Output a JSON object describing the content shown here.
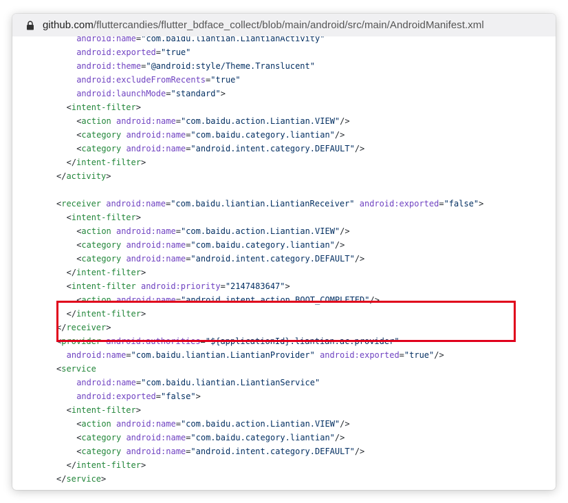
{
  "browser": {
    "url_host": "github.com",
    "url_path": "/fluttercandies/flutter_bdface_collect/blob/main/android/src/main/AndroidManifest.xml",
    "lock_icon": "lock-icon"
  },
  "code": {
    "lines": [
      {
        "indent": 8,
        "tokens": [
          {
            "k": "a",
            "v": "android:name"
          },
          {
            "k": "p",
            "v": "="
          },
          {
            "k": "s",
            "v": "\"com.baidu.liantian.LiantianActivity\""
          }
        ]
      },
      {
        "indent": 8,
        "tokens": [
          {
            "k": "a",
            "v": "android:exported"
          },
          {
            "k": "p",
            "v": "="
          },
          {
            "k": "s",
            "v": "\"true\""
          }
        ]
      },
      {
        "indent": 8,
        "tokens": [
          {
            "k": "a",
            "v": "android:theme"
          },
          {
            "k": "p",
            "v": "="
          },
          {
            "k": "s",
            "v": "\"@android:style/Theme.Translucent\""
          }
        ]
      },
      {
        "indent": 8,
        "tokens": [
          {
            "k": "a",
            "v": "android:excludeFromRecents"
          },
          {
            "k": "p",
            "v": "="
          },
          {
            "k": "s",
            "v": "\"true\""
          }
        ]
      },
      {
        "indent": 8,
        "tokens": [
          {
            "k": "a",
            "v": "android:launchMode"
          },
          {
            "k": "p",
            "v": "="
          },
          {
            "k": "s",
            "v": "\"standard\""
          },
          {
            "k": "p",
            "v": ">"
          }
        ]
      },
      {
        "indent": 4,
        "tokens": [
          {
            "k": "p",
            "v": "<"
          },
          {
            "k": "t",
            "v": "intent-filter"
          },
          {
            "k": "p",
            "v": ">"
          }
        ]
      },
      {
        "indent": 8,
        "tokens": [
          {
            "k": "p",
            "v": "<"
          },
          {
            "k": "t",
            "v": "action"
          },
          {
            "k": "p",
            "v": " "
          },
          {
            "k": "a",
            "v": "android:name"
          },
          {
            "k": "p",
            "v": "="
          },
          {
            "k": "s",
            "v": "\"com.baidu.action.Liantian.VIEW\""
          },
          {
            "k": "p",
            "v": "/>"
          }
        ]
      },
      {
        "indent": 8,
        "tokens": [
          {
            "k": "p",
            "v": "<"
          },
          {
            "k": "t",
            "v": "category"
          },
          {
            "k": "p",
            "v": " "
          },
          {
            "k": "a",
            "v": "android:name"
          },
          {
            "k": "p",
            "v": "="
          },
          {
            "k": "s",
            "v": "\"com.baidu.category.liantian\""
          },
          {
            "k": "p",
            "v": "/>"
          }
        ]
      },
      {
        "indent": 8,
        "tokens": [
          {
            "k": "p",
            "v": "<"
          },
          {
            "k": "t",
            "v": "category"
          },
          {
            "k": "p",
            "v": " "
          },
          {
            "k": "a",
            "v": "android:name"
          },
          {
            "k": "p",
            "v": "="
          },
          {
            "k": "s",
            "v": "\"android.intent.category.DEFAULT\""
          },
          {
            "k": "p",
            "v": "/>"
          }
        ]
      },
      {
        "indent": 4,
        "tokens": [
          {
            "k": "p",
            "v": "</"
          },
          {
            "k": "t",
            "v": "intent-filter"
          },
          {
            "k": "p",
            "v": ">"
          }
        ]
      },
      {
        "indent": 0,
        "tokens": [
          {
            "k": "p",
            "v": "</"
          },
          {
            "k": "t",
            "v": "activity"
          },
          {
            "k": "p",
            "v": ">"
          }
        ]
      },
      {
        "indent": 0,
        "tokens": []
      },
      {
        "indent": 0,
        "tokens": [
          {
            "k": "p",
            "v": "<"
          },
          {
            "k": "t",
            "v": "receiver"
          },
          {
            "k": "p",
            "v": " "
          },
          {
            "k": "a",
            "v": "android:name"
          },
          {
            "k": "p",
            "v": "="
          },
          {
            "k": "s",
            "v": "\"com.baidu.liantian.LiantianReceiver\""
          },
          {
            "k": "p",
            "v": " "
          },
          {
            "k": "a",
            "v": "android:exported"
          },
          {
            "k": "p",
            "v": "="
          },
          {
            "k": "s",
            "v": "\"false\""
          },
          {
            "k": "p",
            "v": ">"
          }
        ]
      },
      {
        "indent": 4,
        "tokens": [
          {
            "k": "p",
            "v": "<"
          },
          {
            "k": "t",
            "v": "intent-filter"
          },
          {
            "k": "p",
            "v": ">"
          }
        ]
      },
      {
        "indent": 8,
        "tokens": [
          {
            "k": "p",
            "v": "<"
          },
          {
            "k": "t",
            "v": "action"
          },
          {
            "k": "p",
            "v": " "
          },
          {
            "k": "a",
            "v": "android:name"
          },
          {
            "k": "p",
            "v": "="
          },
          {
            "k": "s",
            "v": "\"com.baidu.action.Liantian.VIEW\""
          },
          {
            "k": "p",
            "v": "/>"
          }
        ]
      },
      {
        "indent": 8,
        "tokens": [
          {
            "k": "p",
            "v": "<"
          },
          {
            "k": "t",
            "v": "category"
          },
          {
            "k": "p",
            "v": " "
          },
          {
            "k": "a",
            "v": "android:name"
          },
          {
            "k": "p",
            "v": "="
          },
          {
            "k": "s",
            "v": "\"com.baidu.category.liantian\""
          },
          {
            "k": "p",
            "v": "/>"
          }
        ]
      },
      {
        "indent": 8,
        "tokens": [
          {
            "k": "p",
            "v": "<"
          },
          {
            "k": "t",
            "v": "category"
          },
          {
            "k": "p",
            "v": " "
          },
          {
            "k": "a",
            "v": "android:name"
          },
          {
            "k": "p",
            "v": "="
          },
          {
            "k": "s",
            "v": "\"android.intent.category.DEFAULT\""
          },
          {
            "k": "p",
            "v": "/>"
          }
        ]
      },
      {
        "indent": 4,
        "tokens": [
          {
            "k": "p",
            "v": "</"
          },
          {
            "k": "t",
            "v": "intent-filter"
          },
          {
            "k": "p",
            "v": ">"
          }
        ]
      },
      {
        "indent": 4,
        "tokens": [
          {
            "k": "p",
            "v": "<"
          },
          {
            "k": "t",
            "v": "intent-filter"
          },
          {
            "k": "p",
            "v": " "
          },
          {
            "k": "a",
            "v": "android:priority"
          },
          {
            "k": "p",
            "v": "="
          },
          {
            "k": "s",
            "v": "\"2147483647\""
          },
          {
            "k": "p",
            "v": ">"
          }
        ]
      },
      {
        "indent": 8,
        "tokens": [
          {
            "k": "p",
            "v": "<"
          },
          {
            "k": "t",
            "v": "action"
          },
          {
            "k": "p",
            "v": " "
          },
          {
            "k": "a",
            "v": "android:name"
          },
          {
            "k": "p",
            "v": "="
          },
          {
            "k": "s",
            "v": "\"android.intent.action.BOOT_COMPLETED\""
          },
          {
            "k": "p",
            "v": "/>"
          }
        ]
      },
      {
        "indent": 4,
        "tokens": [
          {
            "k": "p",
            "v": "</"
          },
          {
            "k": "t",
            "v": "intent-filter"
          },
          {
            "k": "p",
            "v": ">"
          }
        ]
      },
      {
        "indent": 0,
        "tokens": [
          {
            "k": "p",
            "v": "</"
          },
          {
            "k": "t",
            "v": "receiver"
          },
          {
            "k": "p",
            "v": ">"
          }
        ]
      },
      {
        "indent": 0,
        "tokens": [
          {
            "k": "p",
            "v": "<"
          },
          {
            "k": "t",
            "v": "provider"
          },
          {
            "k": "p",
            "v": " "
          },
          {
            "k": "a",
            "v": "android:authorities"
          },
          {
            "k": "p",
            "v": "="
          },
          {
            "k": "s",
            "v": "\"${applicationId}.liantian.ac.provider\""
          }
        ]
      },
      {
        "indent": 4,
        "tokens": [
          {
            "k": "a",
            "v": "android:name"
          },
          {
            "k": "p",
            "v": "="
          },
          {
            "k": "s",
            "v": "\"com.baidu.liantian.LiantianProvider\""
          },
          {
            "k": "p",
            "v": " "
          },
          {
            "k": "a",
            "v": "android:exported"
          },
          {
            "k": "p",
            "v": "="
          },
          {
            "k": "s",
            "v": "\"true\""
          },
          {
            "k": "p",
            "v": "/>"
          }
        ]
      },
      {
        "indent": 0,
        "tokens": [
          {
            "k": "p",
            "v": "<"
          },
          {
            "k": "t",
            "v": "service"
          }
        ]
      },
      {
        "indent": 8,
        "tokens": [
          {
            "k": "a",
            "v": "android:name"
          },
          {
            "k": "p",
            "v": "="
          },
          {
            "k": "s",
            "v": "\"com.baidu.liantian.LiantianService\""
          }
        ]
      },
      {
        "indent": 8,
        "tokens": [
          {
            "k": "a",
            "v": "android:exported"
          },
          {
            "k": "p",
            "v": "="
          },
          {
            "k": "s",
            "v": "\"false\""
          },
          {
            "k": "p",
            "v": ">"
          }
        ]
      },
      {
        "indent": 4,
        "tokens": [
          {
            "k": "p",
            "v": "<"
          },
          {
            "k": "t",
            "v": "intent-filter"
          },
          {
            "k": "p",
            "v": ">"
          }
        ]
      },
      {
        "indent": 8,
        "tokens": [
          {
            "k": "p",
            "v": "<"
          },
          {
            "k": "t",
            "v": "action"
          },
          {
            "k": "p",
            "v": " "
          },
          {
            "k": "a",
            "v": "android:name"
          },
          {
            "k": "p",
            "v": "="
          },
          {
            "k": "s",
            "v": "\"com.baidu.action.Liantian.VIEW\""
          },
          {
            "k": "p",
            "v": "/>"
          }
        ]
      },
      {
        "indent": 8,
        "tokens": [
          {
            "k": "p",
            "v": "<"
          },
          {
            "k": "t",
            "v": "category"
          },
          {
            "k": "p",
            "v": " "
          },
          {
            "k": "a",
            "v": "android:name"
          },
          {
            "k": "p",
            "v": "="
          },
          {
            "k": "s",
            "v": "\"com.baidu.category.liantian\""
          },
          {
            "k": "p",
            "v": "/>"
          }
        ]
      },
      {
        "indent": 8,
        "tokens": [
          {
            "k": "p",
            "v": "<"
          },
          {
            "k": "t",
            "v": "category"
          },
          {
            "k": "p",
            "v": " "
          },
          {
            "k": "a",
            "v": "android:name"
          },
          {
            "k": "p",
            "v": "="
          },
          {
            "k": "s",
            "v": "\"android.intent.category.DEFAULT\""
          },
          {
            "k": "p",
            "v": "/>"
          }
        ]
      },
      {
        "indent": 4,
        "tokens": [
          {
            "k": "p",
            "v": "</"
          },
          {
            "k": "t",
            "v": "intent-filter"
          },
          {
            "k": "p",
            "v": ">"
          }
        ]
      },
      {
        "indent": 0,
        "tokens": [
          {
            "k": "p",
            "v": "</"
          },
          {
            "k": "t",
            "v": "service"
          },
          {
            "k": "p",
            "v": ">"
          }
        ]
      }
    ]
  },
  "colors": {
    "tag": "#22863a",
    "attribute": "#6f42c1",
    "string": "#032f62",
    "plain": "#24292e",
    "highlight_border": "#e0001b"
  }
}
